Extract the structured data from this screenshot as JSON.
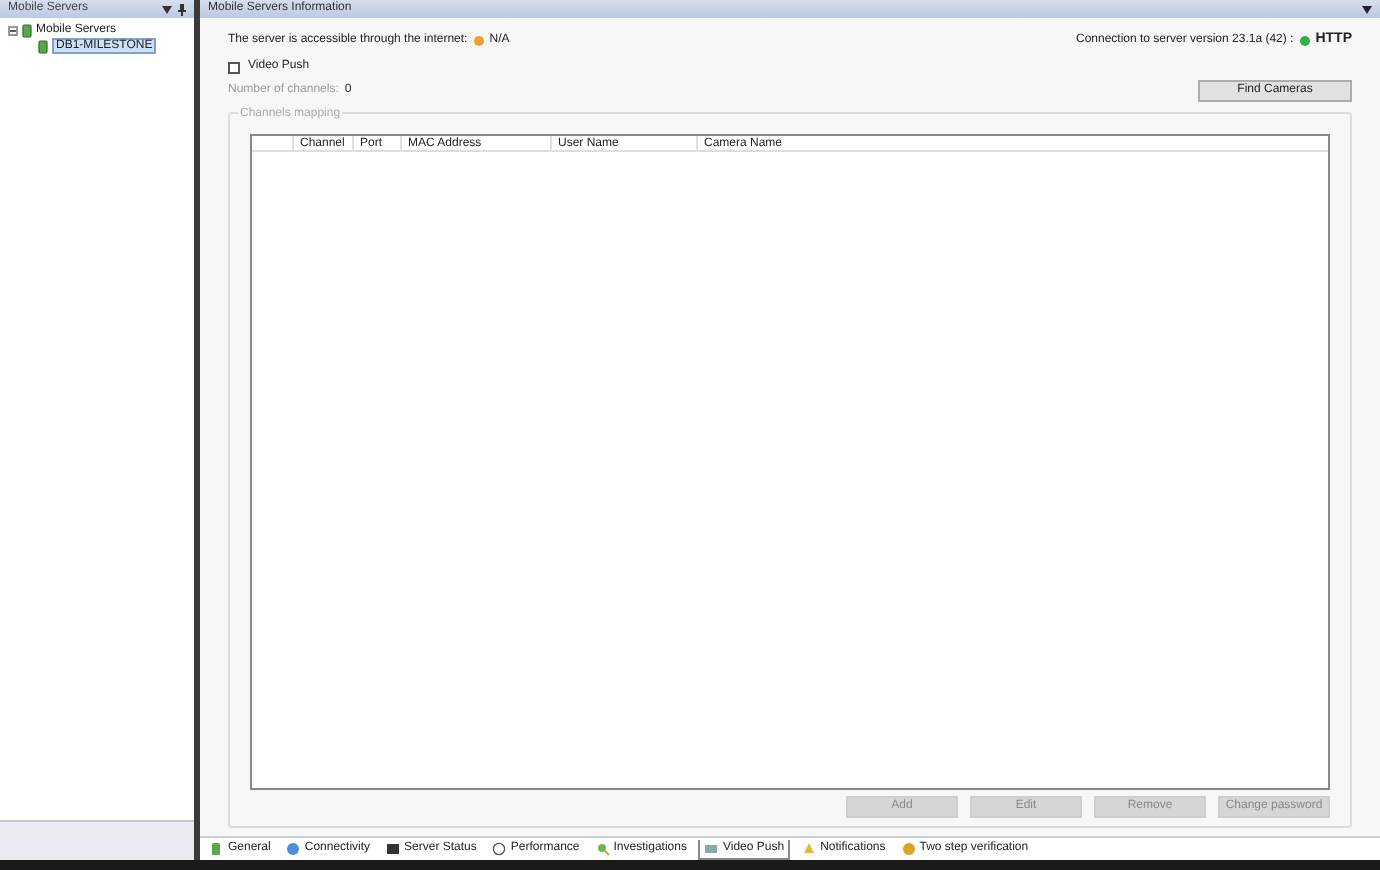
{
  "left_panel": {
    "title": "Mobile Servers",
    "tree": [
      {
        "label": "Mobile Servers",
        "expanded": true,
        "children": [
          {
            "label": "DB1-MILESTONE",
            "selected": true
          }
        ]
      }
    ]
  },
  "main_panel": {
    "title": "Mobile Servers Information",
    "statuses": [
      {
        "label": "The server is accessible through the internet:",
        "value": "N/A",
        "color": "#f0a030"
      },
      {
        "label": "Connection to server version 23.1a (42) :",
        "value": "HTTP",
        "color": "#30b040"
      }
    ],
    "video_push": {
      "label": "Video Push",
      "checked": false
    },
    "channels_label": "Number of channels:",
    "channels_count": "0",
    "find_button": "Find Cameras",
    "group_title": "Channels mapping",
    "columns": [
      "Channel",
      "Port",
      "MAC Address",
      "User Name",
      "Camera Name"
    ],
    "buttons": [
      {
        "label": "Add",
        "disabled": true
      },
      {
        "label": "Edit",
        "disabled": true
      },
      {
        "label": "Remove",
        "disabled": true
      },
      {
        "label": "Change password",
        "disabled": true
      }
    ]
  },
  "tabs": [
    {
      "label": "General",
      "selected": false
    },
    {
      "label": "Connectivity",
      "selected": false
    },
    {
      "label": "Server Status",
      "selected": false
    },
    {
      "label": "Performance",
      "selected": false
    },
    {
      "label": "Investigations",
      "selected": false
    },
    {
      "label": "Video Push",
      "selected": true
    },
    {
      "label": "Notifications",
      "selected": false
    },
    {
      "label": "Two step verification",
      "selected": false
    }
  ]
}
